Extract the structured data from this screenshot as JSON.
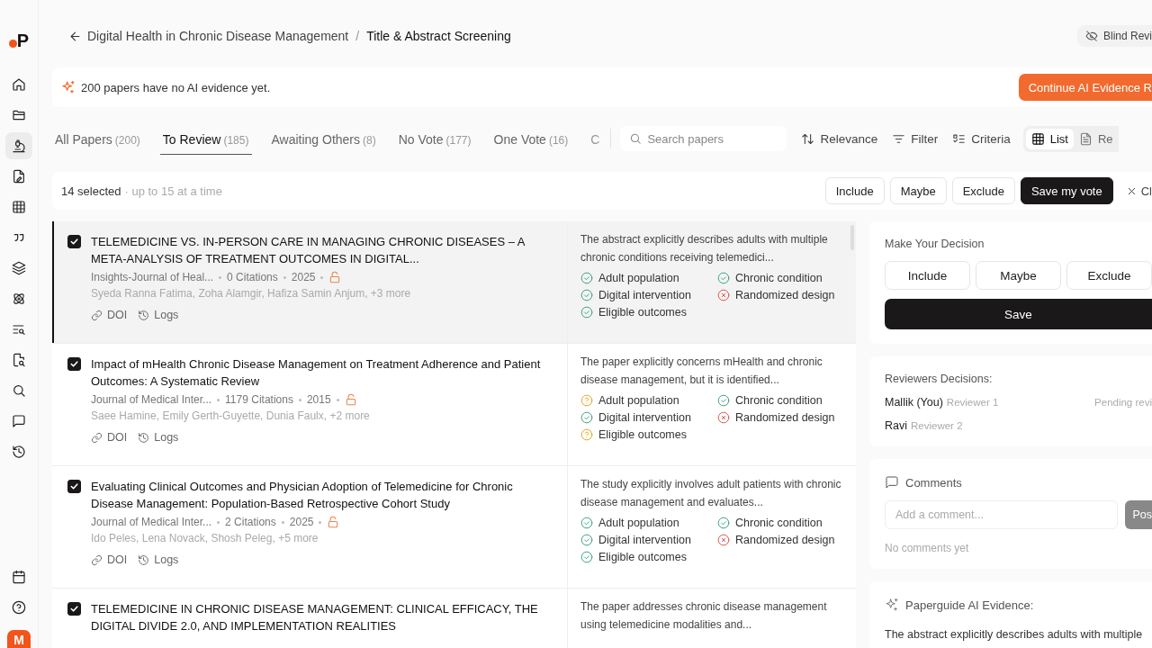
{
  "logo": {
    "text": "P"
  },
  "sidebar": {
    "items": [
      {
        "selected": false
      },
      {
        "selected": false
      },
      {
        "selected": true
      },
      {
        "selected": false
      },
      {
        "selected": false
      },
      {
        "selected": false
      },
      {
        "selected": false
      },
      {
        "selected": false
      },
      {
        "selected": false
      },
      {
        "selected": false
      },
      {
        "selected": false
      },
      {
        "selected": false
      },
      {
        "selected": false
      }
    ],
    "bottom_items": [
      {
        "selected": false
      },
      {
        "selected": false
      }
    ],
    "avatar": {
      "initial": "M"
    }
  },
  "breadcrumb": {
    "parent": "Digital Health in Chronic Disease Management",
    "separator": "/",
    "current": "Title & Abstract Screening"
  },
  "blind_review": {
    "label": "Blind Revi"
  },
  "banner": {
    "message": "200 papers have no AI evidence yet.",
    "action": "Continue AI Evidence R"
  },
  "tabs": [
    {
      "label": "All Papers",
      "count": "(200)",
      "selected": false
    },
    {
      "label": "To Review",
      "count": "(185)",
      "selected": true
    },
    {
      "label": "Awaiting Others",
      "count": "(8)",
      "selected": false
    },
    {
      "label": "No Vote",
      "count": "(177)",
      "selected": false
    },
    {
      "label": "One Vote",
      "count": "(16)",
      "selected": false
    },
    {
      "label": "C",
      "selected": false
    }
  ],
  "toolbar": {
    "search_placeholder": "Search papers",
    "sort": "Relevance",
    "filter": "Filter",
    "criteria": "Criteria",
    "views": [
      {
        "label": "List",
        "selected": true
      },
      {
        "label": "Re",
        "selected": false
      }
    ]
  },
  "selection_bar": {
    "count": "14 selected",
    "note": "· up to 15 at a time",
    "actions": [
      {
        "label": "Include",
        "kind": "outline"
      },
      {
        "label": "Maybe",
        "kind": "outline"
      },
      {
        "label": "Exclude",
        "kind": "outline"
      },
      {
        "label": "Save my vote",
        "kind": "primary"
      },
      {
        "label": "Cl",
        "kind": "clear"
      }
    ]
  },
  "papers": [
    {
      "selected": true,
      "checked": true,
      "title": "TELEMEDICINE VS. IN-PERSON CARE IN MANAGING CHRONIC DISEASES – A META-ANALYSIS OF TREATMENT OUTCOMES IN DIGITAL...",
      "journal": "Insights-Journal of Heal...",
      "citations": "0 Citations",
      "year": "2025",
      "authors": "Syeda Ranna Fatima, Zoha Alamgir, Hafiza Samin Anjum, +3 more",
      "links": [
        "DOI",
        "Logs"
      ],
      "evidence": "The abstract explicitly describes adults with multiple chronic conditions receiving telemedici...",
      "criteria": [
        {
          "label": "Adult population",
          "kind": "met"
        },
        {
          "label": "Chronic condition",
          "kind": "met"
        },
        {
          "label": "Digital intervention",
          "kind": "met"
        },
        {
          "label": "Randomized design",
          "kind": "not_met"
        },
        {
          "label": "Eligible outcomes",
          "kind": "met"
        }
      ]
    },
    {
      "selected": false,
      "checked": true,
      "title": "Impact of mHealth Chronic Disease Management on Treatment Adherence and Patient Outcomes: A Systematic Review",
      "journal": "Journal of Medical Inter...",
      "citations": "1179 Citations",
      "year": "2015",
      "authors": "Saee Hamine, Emily Gerth-Guyette, Dunia Faulx, +2 more",
      "links": [
        "DOI",
        "Logs"
      ],
      "evidence": "The paper explicitly concerns mHealth and chronic disease management, but it is identified...",
      "criteria": [
        {
          "label": "Adult population",
          "kind": "unclear"
        },
        {
          "label": "Chronic condition",
          "kind": "met"
        },
        {
          "label": "Digital intervention",
          "kind": "met"
        },
        {
          "label": "Randomized design",
          "kind": "not_met"
        },
        {
          "label": "Eligible outcomes",
          "kind": "unclear"
        }
      ]
    },
    {
      "selected": false,
      "checked": true,
      "title": "Evaluating Clinical Outcomes and Physician Adoption of Telemedicine for Chronic Disease Management: Population-Based Retrospective Cohort Study",
      "journal": "Journal of Medical Inter...",
      "citations": "2 Citations",
      "year": "2025",
      "authors": "Ido Peles, Lena Novack, Shosh Peleg, +5 more",
      "links": [
        "DOI",
        "Logs"
      ],
      "evidence": "The study explicitly involves adult patients with chronic disease management and evaluates...",
      "criteria": [
        {
          "label": "Adult population",
          "kind": "met"
        },
        {
          "label": "Chronic condition",
          "kind": "met"
        },
        {
          "label": "Digital intervention",
          "kind": "met"
        },
        {
          "label": "Randomized design",
          "kind": "not_met"
        },
        {
          "label": "Eligible outcomes",
          "kind": "met"
        }
      ]
    },
    {
      "selected": false,
      "checked": true,
      "title": "TELEMEDICINE IN CHRONIC DISEASE MANAGEMENT: CLINICAL EFFICACY, THE DIGITAL DIVIDE 2.0, AND IMPLEMENTATION REALITIES",
      "evidence": "The paper addresses chronic disease management using telemedicine modalities and..."
    }
  ],
  "decision_panel": {
    "title": "Make Your Decision",
    "options": [
      "Include",
      "Maybe",
      "Exclude"
    ],
    "save": "Save"
  },
  "reviewers": {
    "title": "Reviewers Decisions:",
    "items": [
      {
        "name": "Mallik (You)",
        "role": "Reviewer 1",
        "status": "Pending revi"
      },
      {
        "name": "Ravi",
        "role": "Reviewer 2"
      }
    ]
  },
  "comments": {
    "title": "Comments",
    "placeholder": "Add a comment...",
    "post": "Pos",
    "empty": "No comments yet"
  },
  "ai_evidence": {
    "title": "Paperguide AI Evidence:",
    "text": "The abstract explicitly describes adults with multiple"
  }
}
